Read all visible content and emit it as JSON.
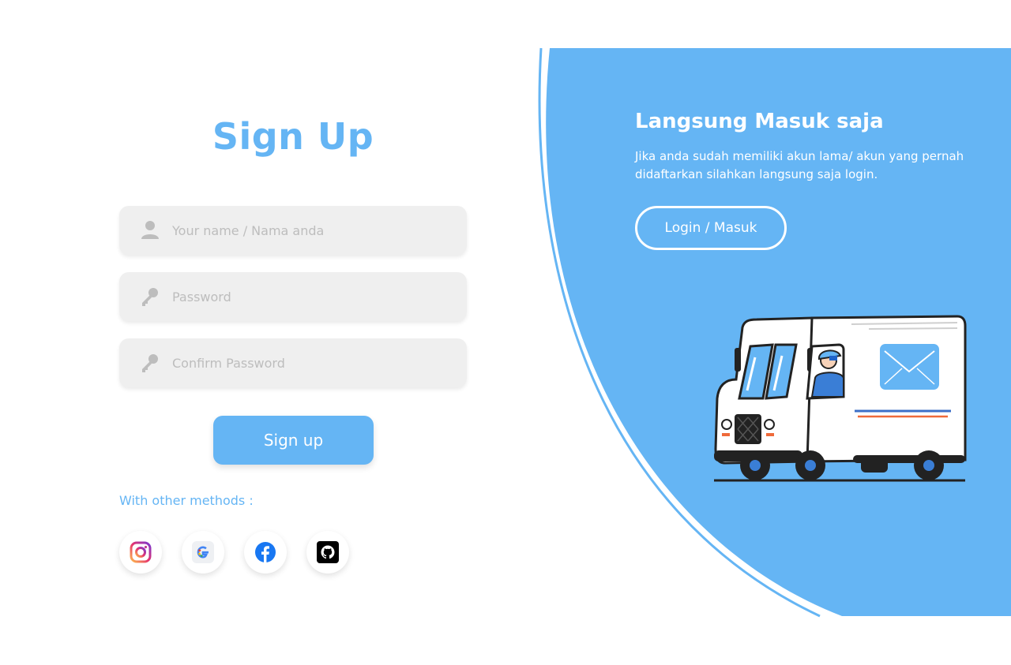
{
  "signup": {
    "title": "Sign Up",
    "name_placeholder": "Your name / Nama anda",
    "password_placeholder": "Password",
    "confirm_placeholder": "Confirm Password",
    "submit_label": "Sign up",
    "other_methods_label": "With other methods :"
  },
  "social": [
    {
      "name": "instagram",
      "icon": "instagram-icon"
    },
    {
      "name": "google",
      "icon": "google-icon"
    },
    {
      "name": "facebook",
      "icon": "facebook-icon"
    },
    {
      "name": "github",
      "icon": "github-icon"
    }
  ],
  "panel": {
    "title": "Langsung Masuk saja",
    "description": "Jika anda sudah memiliki akun lama/ akun yang pernah didaftarkan silahkan langsung saja login.",
    "login_label": "Login / Masuk"
  },
  "colors": {
    "accent": "#65b5f4",
    "field_bg": "#efefef",
    "placeholder": "#bdbdbd"
  }
}
